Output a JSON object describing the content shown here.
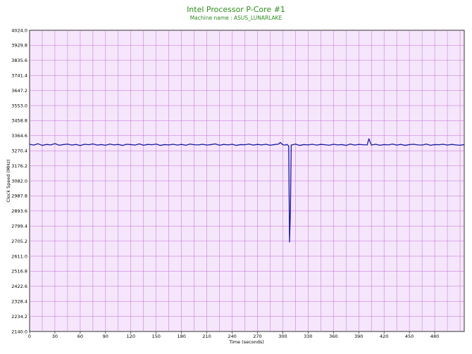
{
  "chart_data": {
    "type": "line",
    "title": "Intel Processor P-Core #1",
    "subtitle": "Machine name : ASUS_LUNARLAKE",
    "xlabel": "Time (seconds)",
    "ylabel": "Clock Speed (MHz)",
    "xlim": [
      0,
      515
    ],
    "ylim": [
      2140.0,
      4024.0
    ],
    "x_ticks": [
      "0",
      "30",
      "60",
      "90",
      "120",
      "150",
      "180",
      "210",
      "240",
      "270",
      "300",
      "330",
      "360",
      "390",
      "420",
      "450",
      "480"
    ],
    "y_ticks": [
      "4024.0",
      "3929.8",
      "3835.6",
      "3741.4",
      "3647.2",
      "3553.0",
      "3458.8",
      "3364.6",
      "3270.4",
      "3176.2",
      "3082.0",
      "2987.8",
      "2893.6",
      "2799.4",
      "2705.2",
      "2611.0",
      "2516.8",
      "2422.6",
      "2328.4",
      "2234.2",
      "2140.0"
    ],
    "grid": true,
    "colors": {
      "plot_background": "#f5e6fb",
      "grid": "#c46ad8",
      "line": "#1a1aa0",
      "title": "#2e8b1e"
    },
    "series": [
      {
        "name": "",
        "x": [
          0,
          5,
          10,
          15,
          20,
          25,
          30,
          35,
          40,
          45,
          50,
          55,
          60,
          65,
          70,
          75,
          80,
          85,
          90,
          95,
          100,
          105,
          110,
          115,
          120,
          125,
          130,
          135,
          140,
          145,
          150,
          155,
          160,
          165,
          170,
          175,
          180,
          185,
          190,
          195,
          200,
          205,
          210,
          215,
          220,
          225,
          230,
          235,
          240,
          245,
          250,
          255,
          260,
          265,
          270,
          275,
          280,
          285,
          290,
          295,
          297,
          300,
          303,
          305,
          307,
          308,
          309,
          310,
          315,
          320,
          325,
          330,
          335,
          340,
          345,
          350,
          355,
          360,
          365,
          370,
          375,
          380,
          385,
          390,
          395,
          400,
          402,
          405,
          410,
          415,
          420,
          425,
          430,
          435,
          440,
          445,
          450,
          455,
          460,
          465,
          470,
          475,
          480,
          485,
          490,
          495,
          500,
          505,
          510,
          515
        ],
        "values": [
          3311,
          3306,
          3314,
          3304,
          3310,
          3307,
          3315,
          3305,
          3309,
          3312,
          3306,
          3310,
          3303,
          3311,
          3308,
          3313,
          3306,
          3309,
          3305,
          3312,
          3307,
          3310,
          3304,
          3311,
          3309,
          3306,
          3313,
          3305,
          3310,
          3308,
          3312,
          3304,
          3309,
          3307,
          3311,
          3306,
          3310,
          3305,
          3312,
          3308,
          3307,
          3311,
          3306,
          3309,
          3313,
          3305,
          3310,
          3307,
          3311,
          3304,
          3309,
          3308,
          3312,
          3306,
          3310,
          3307,
          3311,
          3305,
          3309,
          3312,
          3322,
          3308,
          3306,
          3310,
          3300,
          2700,
          2880,
          3306,
          3312,
          3304,
          3309,
          3307,
          3311,
          3306,
          3310,
          3308,
          3305,
          3311,
          3307,
          3309,
          3304,
          3312,
          3306,
          3310,
          3308,
          3307,
          3345,
          3306,
          3311,
          3305,
          3309,
          3307,
          3312,
          3306,
          3310,
          3304,
          3309,
          3311,
          3307,
          3306,
          3312,
          3305,
          3309,
          3308,
          3311,
          3306,
          3310,
          3307,
          3305,
          3309
        ]
      }
    ]
  }
}
